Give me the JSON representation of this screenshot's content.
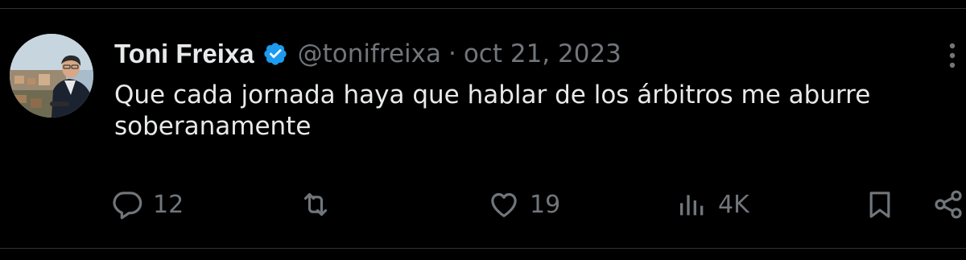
{
  "tweet": {
    "author_name": "Toni Freixa",
    "handle": "@tonifreixa",
    "separator": "·",
    "date": "oct 21, 2023",
    "text_line1": "Que cada jornada haya que hablar de los árbitros me aburre",
    "text_line2": "soberanamente",
    "verified": true
  },
  "actions": {
    "reply_count": "12",
    "retweet_count": "",
    "like_count": "19",
    "views_count": "4K"
  },
  "icons": {
    "verified": "verified-badge-icon",
    "more": "more-options-icon",
    "reply": "reply-icon",
    "retweet": "retweet-icon",
    "like": "heart-icon",
    "views": "views-chart-icon",
    "bookmark": "bookmark-icon",
    "share": "share-icon"
  },
  "colors": {
    "background": "#000000",
    "text_primary": "#e7e9ea",
    "text_secondary": "#71767b",
    "verified_blue": "#1d9bf0",
    "divider": "#2f3336"
  }
}
